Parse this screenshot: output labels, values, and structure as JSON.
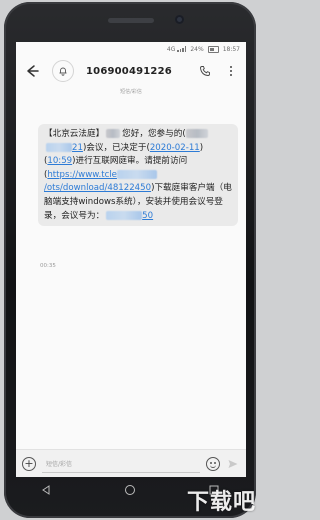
{
  "status_bar": {
    "network": "4G",
    "battery": "24%",
    "time": "18:57"
  },
  "header": {
    "title": "106900491226"
  },
  "sim_tag": "短信/彩信",
  "message": {
    "p1": "【北京云法庭】",
    "p2": "您好，您参与的(",
    "p3": "21",
    "p4": ")会议，已决定于(",
    "date": "2020-02-11",
    "p5": ")(",
    "clock": "10:59",
    "p6": ")进行互联网庭审。请提前访问(",
    "url_a": "https://www",
    "url_b": ".tcle",
    "url_c": "/ots/download",
    "url_d": "/48122450",
    "p7": ")下载庭审客户端（电脑端支持windows系统），安装并使用会议号登录，会议号为：",
    "meeting_id_tail": "50"
  },
  "timestamp": "00:35",
  "composer": {
    "placeholder": "短信/彩信"
  },
  "watermark": "下载吧"
}
